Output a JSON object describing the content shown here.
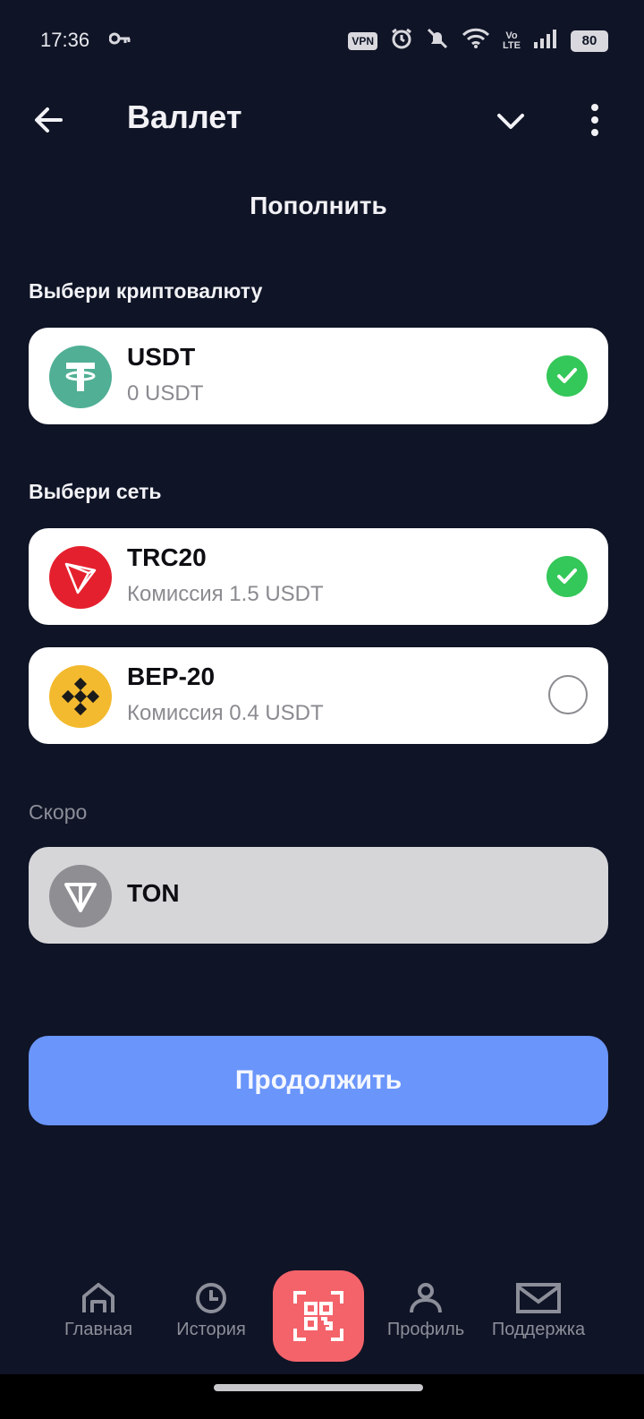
{
  "status_bar": {
    "time": "17:36",
    "vpn": "VPN",
    "volte_top": "Vo",
    "volte_bottom": "LTE",
    "battery": "80"
  },
  "header": {
    "title": "Валлет",
    "subtitle": "Пополнить"
  },
  "crypto_section": {
    "label": "Выбери криптовалюту",
    "items": [
      {
        "title": "USDT",
        "subtitle": "0 USDT",
        "icon": "tether-icon",
        "selected": true
      }
    ]
  },
  "network_section": {
    "label": "Выбери сеть",
    "items": [
      {
        "title": "TRC20",
        "subtitle": "Комиссия 1.5 USDT",
        "icon": "tron-icon",
        "selected": true
      },
      {
        "title": "BEP-20",
        "subtitle": "Комиссия 0.4 USDT",
        "icon": "binance-icon",
        "selected": false
      }
    ]
  },
  "soon_section": {
    "label": "Скоро",
    "items": [
      {
        "title": "TON",
        "icon": "ton-icon"
      }
    ]
  },
  "continue_button": "Продолжить",
  "nav": {
    "items": [
      {
        "label": "Главная",
        "icon": "home-icon"
      },
      {
        "label": "История",
        "icon": "clock-icon"
      },
      {
        "label": "",
        "icon": "qr-scan-icon"
      },
      {
        "label": "Профиль",
        "icon": "profile-icon"
      },
      {
        "label": "Поддержка",
        "icon": "mail-icon"
      }
    ]
  },
  "colors": {
    "background": "#0f1426",
    "accent_button": "#6a95fb",
    "scan_button": "#f4636a",
    "selected_check": "#34c759",
    "tether": "#50af95",
    "tron": "#e5202e",
    "binance": "#f3ba2f",
    "ton_disabled": "#8e8e93"
  }
}
